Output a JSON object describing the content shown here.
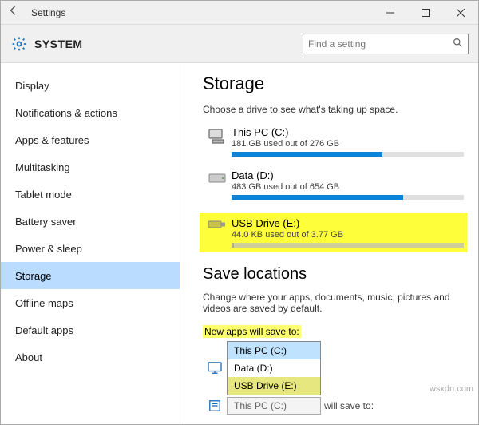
{
  "window": {
    "title": "Settings",
    "section": "SYSTEM",
    "search_placeholder": "Find a setting"
  },
  "sidebar": {
    "items": [
      {
        "label": "Display"
      },
      {
        "label": "Notifications & actions"
      },
      {
        "label": "Apps & features"
      },
      {
        "label": "Multitasking"
      },
      {
        "label": "Tablet mode"
      },
      {
        "label": "Battery saver"
      },
      {
        "label": "Power & sleep"
      },
      {
        "label": "Storage",
        "selected": true
      },
      {
        "label": "Offline maps"
      },
      {
        "label": "Default apps"
      },
      {
        "label": "About"
      }
    ]
  },
  "main": {
    "storage": {
      "heading": "Storage",
      "subheading": "Choose a drive to see what's taking up space.",
      "drives": [
        {
          "name": "This PC (C:)",
          "usage_text": "181 GB used out of 276 GB",
          "fill_pct": 65,
          "highlight": false,
          "icon": "pc"
        },
        {
          "name": "Data (D:)",
          "usage_text": "483 GB used out of 654 GB",
          "fill_pct": 74,
          "highlight": false,
          "icon": "hdd"
        },
        {
          "name": "USB Drive (E:)",
          "usage_text": "44.0 KB used out of 3.77 GB",
          "fill_pct": 1,
          "highlight": true,
          "icon": "usb"
        }
      ]
    },
    "save_locations": {
      "heading": "Save locations",
      "subheading": "Change where your apps, documents, music, pictures and videos are saved by default.",
      "rows": [
        {
          "label": "New apps will save to:",
          "label_highlight": true,
          "options": [
            {
              "label": "This PC (C:)",
              "selected": true
            },
            {
              "label": "Data (D:)"
            },
            {
              "label": "USB Drive (E:)",
              "highlight": true
            }
          ]
        }
      ],
      "next_row_trailing": "will save to:",
      "next_row_value": "This PC (C:)"
    }
  },
  "watermark": "wsxdn.com"
}
